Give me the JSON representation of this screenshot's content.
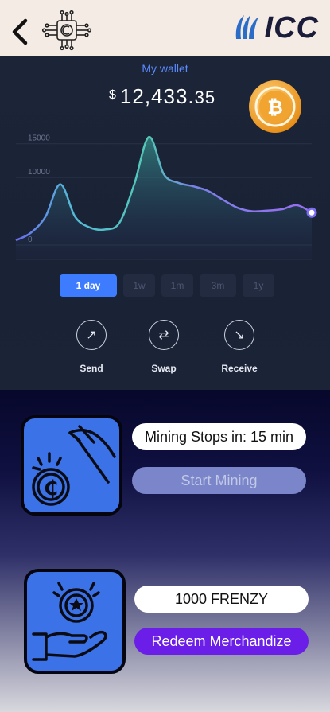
{
  "header": {
    "back_icon": "chevron-left-icon",
    "app_logo": "circuit-coin-icon",
    "brand_logo_text": "ICC"
  },
  "wallet": {
    "title": "My wallet",
    "currency": "$",
    "balance_main": "12,433.",
    "balance_cents": "35",
    "coin_icon": "bitcoin-icon"
  },
  "chart_data": {
    "type": "area",
    "x": [
      0,
      5,
      10,
      15,
      20,
      25,
      30,
      35,
      40,
      45,
      50,
      55,
      60,
      65,
      70,
      75,
      80,
      85,
      90,
      95,
      100
    ],
    "values": [
      700,
      1800,
      4200,
      9000,
      4200,
      2600,
      2300,
      3300,
      9000,
      16000,
      10500,
      9200,
      8700,
      8000,
      6700,
      5500,
      5000,
      5100,
      5300,
      5900,
      4800
    ],
    "y_ticks": [
      "15000",
      "10000",
      "0"
    ],
    "ylim": [
      0,
      16500
    ],
    "grid": true,
    "legend": "none"
  },
  "periods": [
    {
      "label": "1 day",
      "active": true
    },
    {
      "label": "1w",
      "active": false
    },
    {
      "label": "1m",
      "active": false
    },
    {
      "label": "3m",
      "active": false
    },
    {
      "label": "1y",
      "active": false
    }
  ],
  "actions": {
    "send": "Send",
    "swap": "Swap",
    "receive": "Receive"
  },
  "mining": {
    "status": "Mining Stops in: 15 min",
    "button": "Start Mining",
    "tile_icon": "pickaxe-coin-icon"
  },
  "rewards": {
    "amount": "1000 FRENZY",
    "button": "Redeem Merchandize",
    "tile_icon": "hand-coin-icon"
  },
  "colors": {
    "accent": "#3d7bff",
    "tile": "#3c72e8",
    "redeem": "#6a1ee8",
    "header": "#f4ebe4"
  }
}
